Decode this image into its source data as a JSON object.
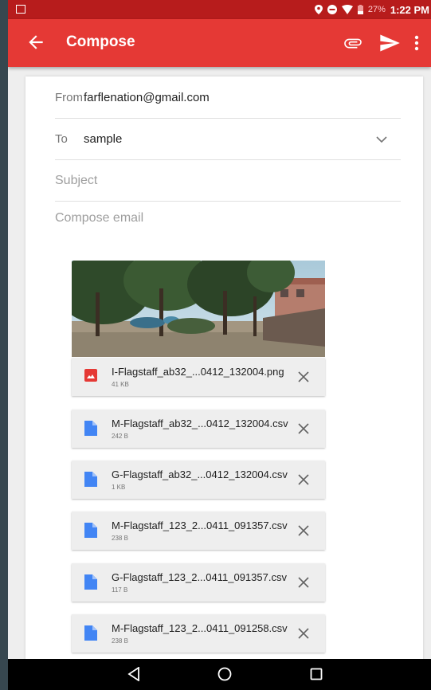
{
  "status_bar": {
    "battery_percent": "27%",
    "time": "1:22 PM",
    "icons": [
      "image-notification-icon",
      "location-icon",
      "do-not-disturb-icon",
      "wifi-icon",
      "battery-icon"
    ]
  },
  "app_bar": {
    "title": "Compose",
    "icons": [
      "back-arrow-icon",
      "paperclip-icon",
      "send-icon",
      "more-vert-icon"
    ]
  },
  "compose": {
    "from_label": "From",
    "from_value": "farflenation@gmail.com",
    "to_label": "To",
    "to_value": "sample",
    "subject_placeholder": "Subject",
    "body_placeholder": "Compose email"
  },
  "attachments": [
    {
      "name": "I-Flagstaff_ab32_...0412_132004.png",
      "size": "41 KB",
      "type": "image",
      "icon": "image-file-icon",
      "color": "#e53935"
    },
    {
      "name": "M-Flagstaff_ab32_...0412_132004.csv",
      "size": "242 B",
      "type": "document",
      "icon": "document-file-icon",
      "color": "#4285f4"
    },
    {
      "name": "G-Flagstaff_ab32_...0412_132004.csv",
      "size": "1 KB",
      "type": "document",
      "icon": "document-file-icon",
      "color": "#4285f4"
    },
    {
      "name": "M-Flagstaff_123_2...0411_091357.csv",
      "size": "238 B",
      "type": "document",
      "icon": "document-file-icon",
      "color": "#4285f4"
    },
    {
      "name": "G-Flagstaff_123_2...0411_091357.csv",
      "size": "117 B",
      "type": "document",
      "icon": "document-file-icon",
      "color": "#4285f4"
    },
    {
      "name": "M-Flagstaff_123_2...0411_091258.csv",
      "size": "238 B",
      "type": "document",
      "icon": "document-file-icon",
      "color": "#4285f4"
    }
  ],
  "nav_bar": {
    "icons": [
      "back-triangle-icon",
      "home-circle-icon",
      "recents-square-icon"
    ]
  },
  "colors": {
    "app_bar": "#e53935",
    "status_bar": "#b71c1c",
    "card": "#ffffff"
  }
}
